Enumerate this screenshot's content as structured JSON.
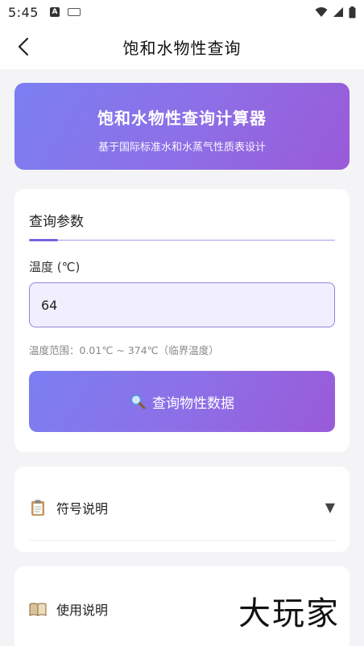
{
  "status_bar": {
    "time": "5:45",
    "left_icons": [
      "a-icon",
      "keyboard-icon"
    ],
    "right_icons": [
      "wifi-icon",
      "signal-icon",
      "battery-icon"
    ]
  },
  "header": {
    "title": "饱和水物性查询",
    "back_icon": "back-arrow-icon"
  },
  "banner": {
    "title": "饱和水物性查询计算器",
    "subtitle": "基于国际标准水和水蒸气性质表设计"
  },
  "query_card": {
    "tab_label": "查询参数",
    "temp_label": "温度 (℃)",
    "temp_value": "64",
    "range_hint": "温度范围：0.01℃ ~ 374℃（临界温度）",
    "button_label": "查询物性数据",
    "button_icon": "magnifier-icon"
  },
  "sections": {
    "symbols": {
      "label": "符号说明",
      "icon": "clipboard-icon",
      "chevron": "▼"
    },
    "usage": {
      "label": "使用说明",
      "icon": "book-icon"
    }
  },
  "watermark": {
    "text": "大玩家"
  },
  "colors": {
    "accent_start": "#7b7ff2",
    "accent_end": "#9a5ad8",
    "input_bg": "#f1effd",
    "page_bg": "#f4f4f6"
  }
}
